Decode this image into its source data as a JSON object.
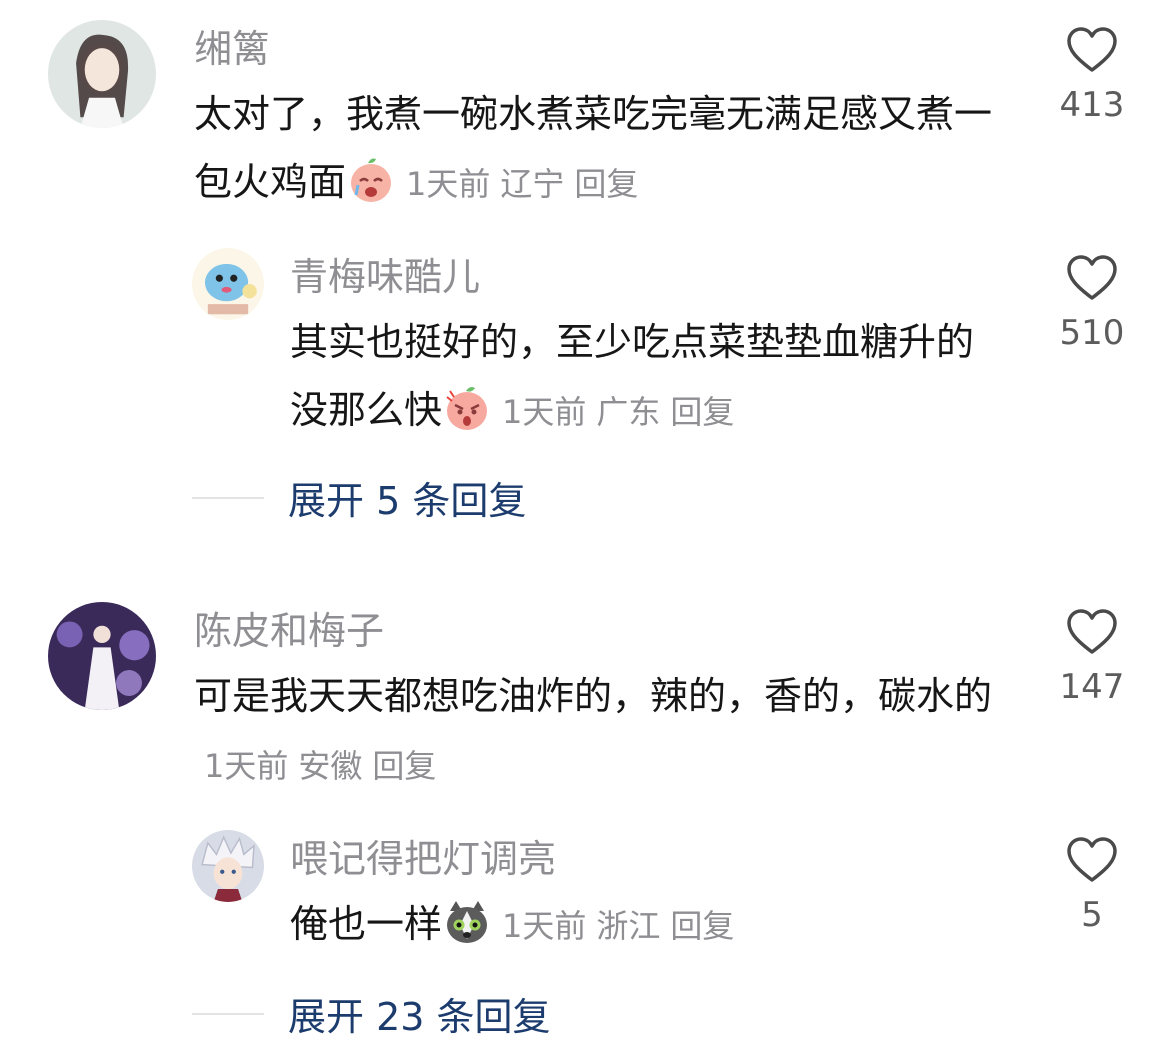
{
  "comments": [
    {
      "username": "缃篱",
      "text": "太对了，我煮一碗水煮菜吃完毫无满足感又煮一包火鸡面",
      "emoji": "crying-peach-emoji",
      "time": "1天前",
      "location": "辽宁",
      "reply_label": "回复",
      "likes": "413",
      "replies": [
        {
          "username": "青梅味酷儿",
          "text": "其实也挺好的，至少吃点菜垫垫血糖升的没那么快",
          "emoji": "shocked-peach-emoji",
          "time": "1天前",
          "location": "广东",
          "reply_label": "回复",
          "likes": "510"
        }
      ],
      "expand_label": "展开 5 条回复"
    },
    {
      "username": "陈皮和梅子",
      "text": "可是我天天都想吃油炸的，辣的，香的，碳水的",
      "time": "1天前",
      "location": "安徽",
      "reply_label": "回复",
      "likes": "147",
      "replies": [
        {
          "username": "喂记得把灯调亮",
          "text": "俺也一样",
          "emoji": "husky-emoji",
          "time": "1天前",
          "location": "浙江",
          "reply_label": "回复",
          "likes": "5"
        }
      ],
      "expand_label": "展开 23 条回复"
    }
  ],
  "colors": {
    "username": "#8e8e93",
    "text": "#161616",
    "expand": "#1d3c6e",
    "heart": "#4a4a4a"
  }
}
